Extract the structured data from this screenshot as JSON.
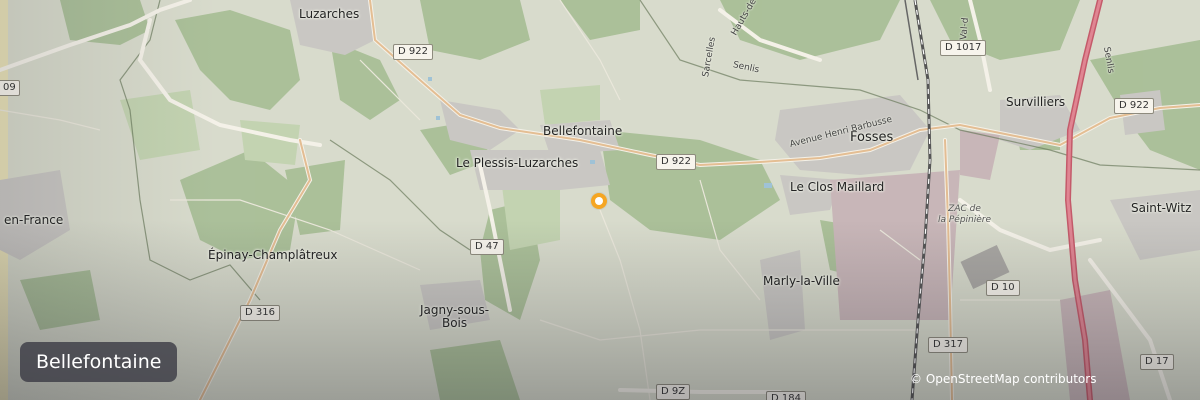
{
  "map": {
    "title": "Bellefontaine",
    "attribution": "© OpenStreetMap contributors",
    "marker_color": "#f5a623",
    "places": {
      "luzarches": "Luzarches",
      "bellefontaine": "Bellefontaine",
      "le_plessis": "Le Plessis-Luzarches",
      "fosses": "Fosses",
      "le_clos_maillard": "Le Clos Maillard",
      "marly": "Marly-la-Ville",
      "survilliers": "Survilliers",
      "saint_witz": "Saint-Witz",
      "epinay": "Épinay-Champlâtreux",
      "jagny_1": "Jagny-sous-",
      "jagny_2": "Bois",
      "en_france": "en-France",
      "zac_1": "ZAC de",
      "zac_2": "la Pépinière"
    },
    "roads": {
      "d922_a": "D 922",
      "d922_b": "D 922",
      "d922_c": "D 922",
      "d1017": "D 1017",
      "d47": "D 47",
      "d316": "D 316",
      "d10": "D 10",
      "d317": "D 317",
      "d17": "D 17",
      "d9z": "D 9Z",
      "d184": "D 184",
      "d09": "09"
    },
    "road_names": {
      "avenue": "Avenue Henri Barbusse",
      "senlis_1": "Senlis",
      "senlis_2": "Senlis",
      "sarcelles": "Sarcelles",
      "hauts": "Hauts-de",
      "val": "Val-d"
    }
  }
}
